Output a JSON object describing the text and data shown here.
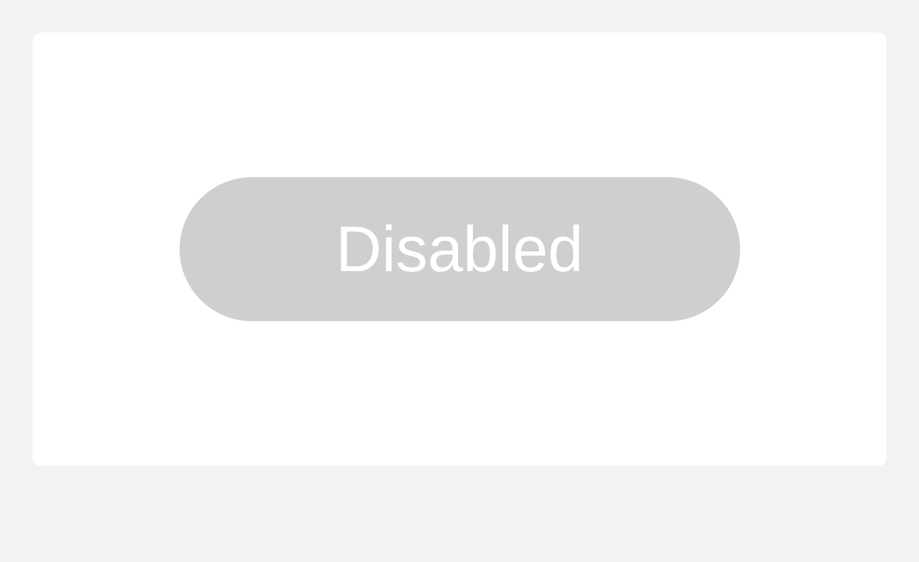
{
  "button": {
    "label": "Disabled",
    "disabled": true
  }
}
